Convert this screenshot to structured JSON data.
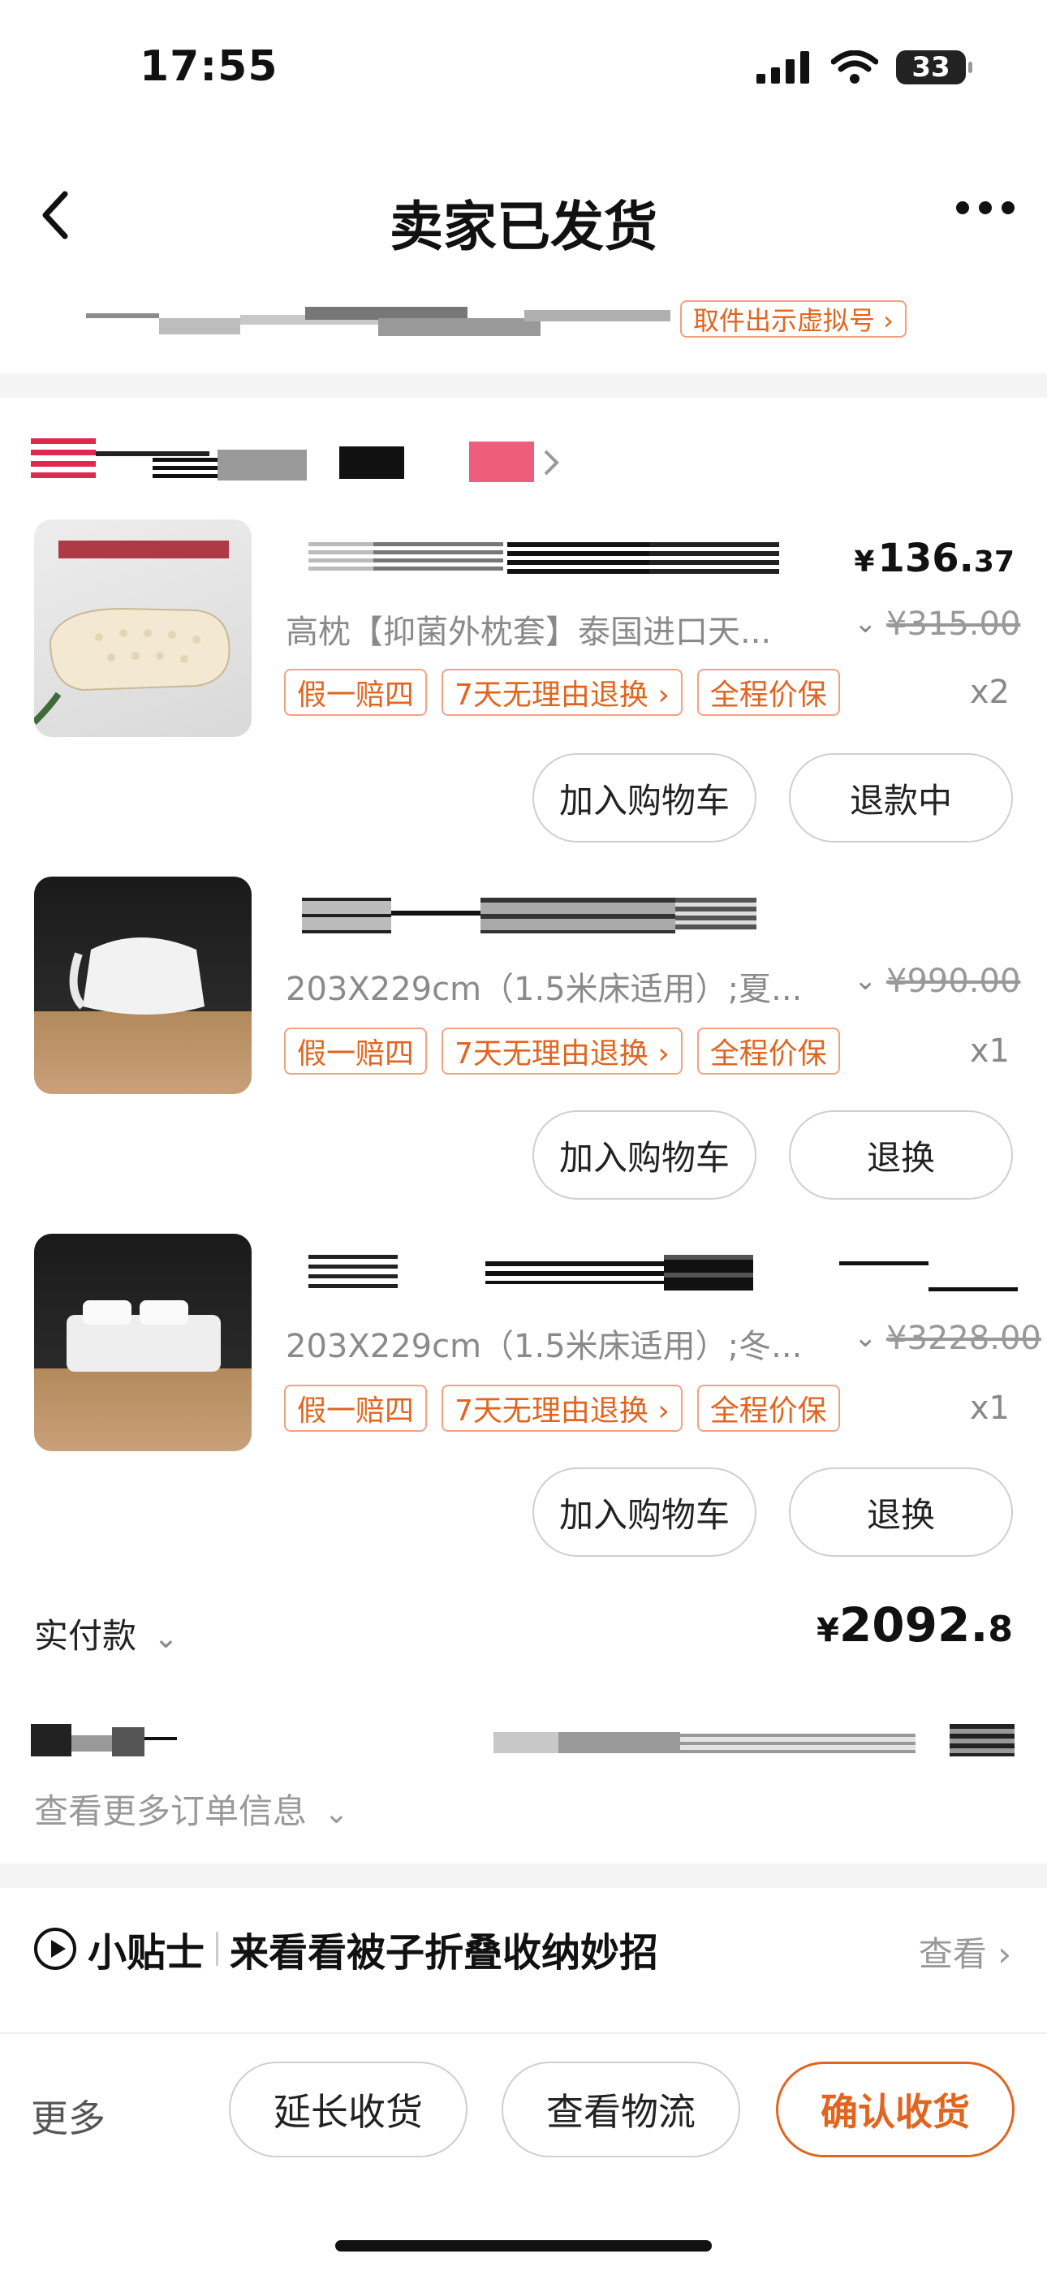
{
  "status_bar": {
    "time": "17:55",
    "battery": "33"
  },
  "nav": {
    "title": "卖家已发货"
  },
  "pickup": {
    "label": "取件出示虚拟号 ›"
  },
  "items": [
    {
      "spec": "高枕【抑菌外枕套】泰国进口天...",
      "price_main": "136.",
      "price_small": "37",
      "orig_price": "¥315.00",
      "qty": "x2",
      "tags": [
        "假一赔四",
        "7天无理由退换 ›",
        "全程价保"
      ],
      "btn_cart": "加入购物车",
      "btn_action": "退款中"
    },
    {
      "spec": "203X229cm（1.5米床适用）;夏...",
      "orig_price": "¥990.00",
      "qty": "x1",
      "tags": [
        "假一赔四",
        "7天无理由退换 ›",
        "全程价保"
      ],
      "btn_cart": "加入购物车",
      "btn_action": "退换"
    },
    {
      "spec": "203X229cm（1.5米床适用）;冬...",
      "orig_price": "¥3228.00",
      "qty": "x1",
      "tags": [
        "假一赔四",
        "7天无理由退换 ›",
        "全程价保"
      ],
      "btn_cart": "加入购物车",
      "btn_action": "退换"
    }
  ],
  "payment": {
    "label": "实付款",
    "currency": "¥",
    "amount_main": "2092.",
    "amount_small": "8"
  },
  "more_info": "查看更多订单信息",
  "tip": {
    "title": "小贴士",
    "text": "来看看被子折叠收纳妙招",
    "view": "查看 ›"
  },
  "bottom": {
    "more": "更多",
    "extend": "延长收货",
    "logistics": "查看物流",
    "confirm": "确认收货"
  },
  "colors": {
    "accent": "#e2651f",
    "accent_border": "#f2a283",
    "muted": "#999999"
  }
}
